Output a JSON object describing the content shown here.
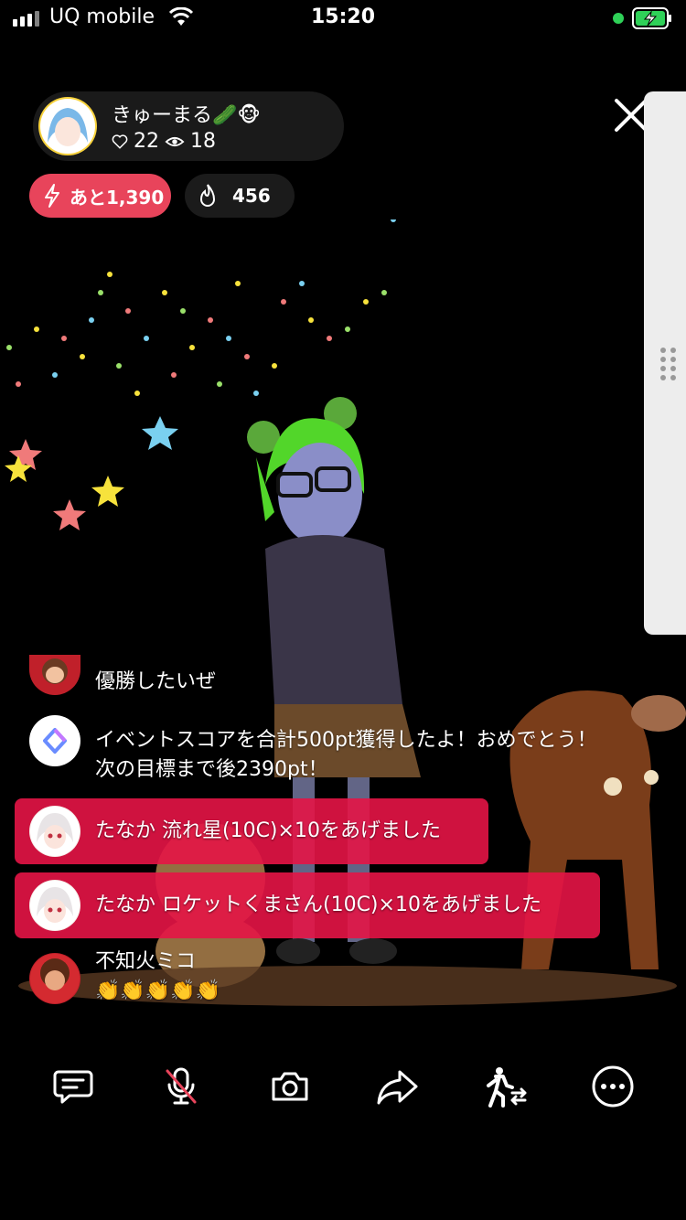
{
  "status_bar": {
    "carrier": "UQ mobile",
    "time": "15:20"
  },
  "host": {
    "name": "きゅーまる🥒🐵",
    "likes": "22",
    "viewers": "18"
  },
  "badges": {
    "remaining": "あと1,390",
    "fire_count": "456"
  },
  "chat": [
    {
      "type": "comment",
      "text": "優勝したいぜ"
    },
    {
      "type": "system",
      "text": "イベントスコアを合計500pt獲得したよ！おめでとう！次の目標まで後2390pt！"
    },
    {
      "type": "gift",
      "text": "たなか 流れ星(10C)×10をあげました"
    },
    {
      "type": "gift",
      "text": "たなか ロケットくまさん(10C)×10をあげました"
    },
    {
      "type": "comment",
      "name": "不知火ミコ",
      "text": "👏👏👏👏👏"
    }
  ],
  "colors": {
    "accent": "#e8445b",
    "gift_bg": "#e6144a",
    "status_green": "#2fd158"
  },
  "toolbar": {
    "icons": [
      "comment-icon",
      "mic-off-icon",
      "camera-icon",
      "share-icon",
      "collab-icon",
      "more-icon"
    ]
  }
}
